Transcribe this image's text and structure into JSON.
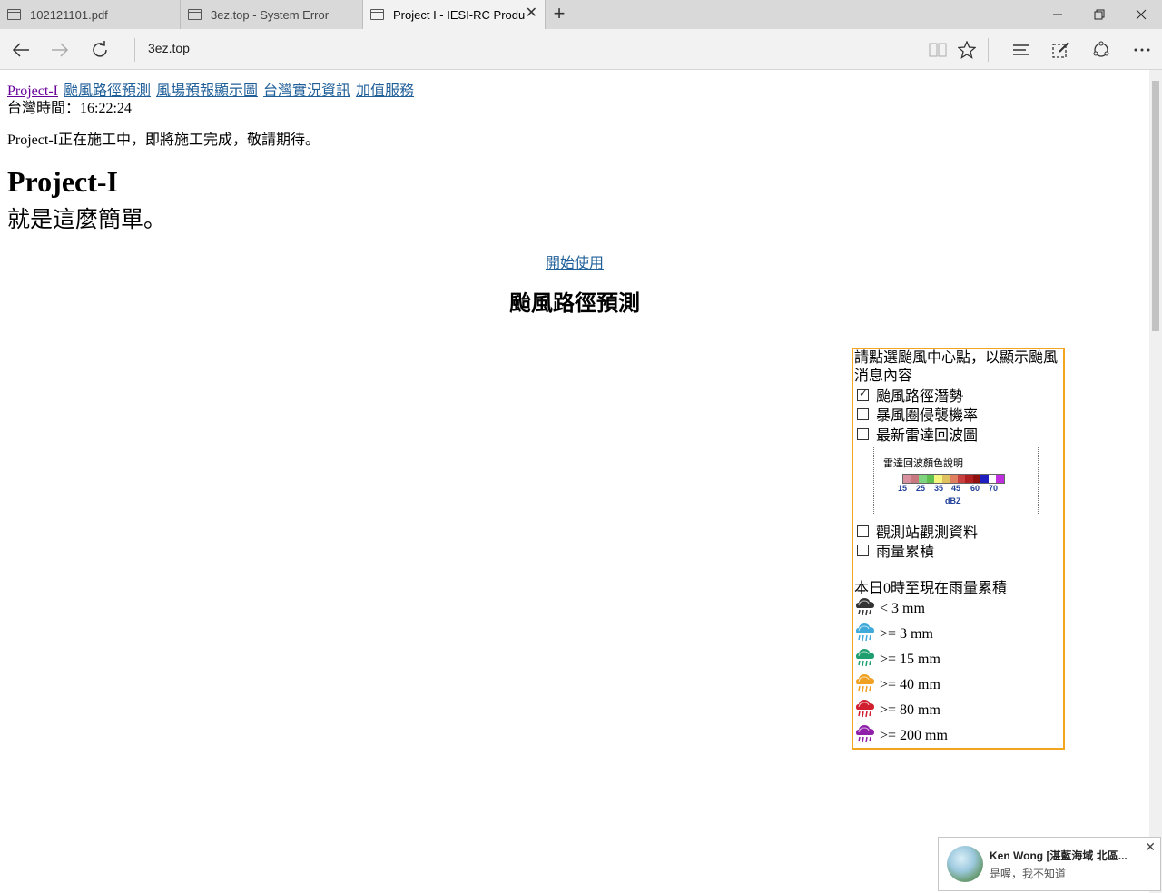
{
  "browser": {
    "tabs": [
      {
        "title": "102121101.pdf"
      },
      {
        "title": "3ez.top - System Error"
      },
      {
        "title": "Project I - IESI-RC Produ"
      }
    ],
    "url": "3ez.top"
  },
  "page": {
    "nav": [
      "Project-I",
      "颱風路徑預測",
      "風場預報顯示圖",
      "台灣實況資訊",
      "加值服務"
    ],
    "taiwan_time": "台灣時間：16:22:24",
    "notice": "Project-I正在施工中，即將施工完成，敬請期待。",
    "heading": "Project-I",
    "slogan": "就是這麼簡單。",
    "start_link": "開始使用",
    "section_title": "颱風路徑預測"
  },
  "panel": {
    "prompt": "請點選颱風中心點，以顯示颱風消息內容",
    "options": [
      {
        "label": "颱風路徑潛勢",
        "checked": true
      },
      {
        "label": "暴風圈侵襲機率",
        "checked": false
      },
      {
        "label": "最新雷達回波圖",
        "checked": false
      },
      {
        "label": "觀測站觀測資料",
        "checked": false
      },
      {
        "label": "雨量累積",
        "checked": false
      }
    ],
    "radar": {
      "title": "雷達回波顏色說明",
      "ticks": [
        "15",
        "25",
        "35",
        "45",
        "60",
        "70"
      ],
      "unit": "dBZ",
      "colors": [
        "#d9909f",
        "#c8787f",
        "#7fd47f",
        "#5fbf4f",
        "#f5f57f",
        "#dfc15f",
        "#df7f5f",
        "#c83f3f",
        "#af1f1f",
        "#8f0f0f",
        "#1f1fbf",
        "#ffffff",
        "#bf2fdf"
      ]
    },
    "rain_heading": "本日0時至現在雨量累積",
    "rain_levels": [
      {
        "label": "< 3 mm",
        "color": "#333333"
      },
      {
        "label": ">= 3 mm",
        "color": "#3fa9d9"
      },
      {
        "label": ">= 15 mm",
        "color": "#1f9f6f"
      },
      {
        "label": ">= 40 mm",
        "color": "#f0a020"
      },
      {
        "label": ">= 80 mm",
        "color": "#d01f2f"
      },
      {
        "label": ">= 200 mm",
        "color": "#8f1fa9"
      }
    ]
  },
  "toast": {
    "name": "Ken Wong [湛藍海域 北區...",
    "message": "是喔，我不知道"
  }
}
